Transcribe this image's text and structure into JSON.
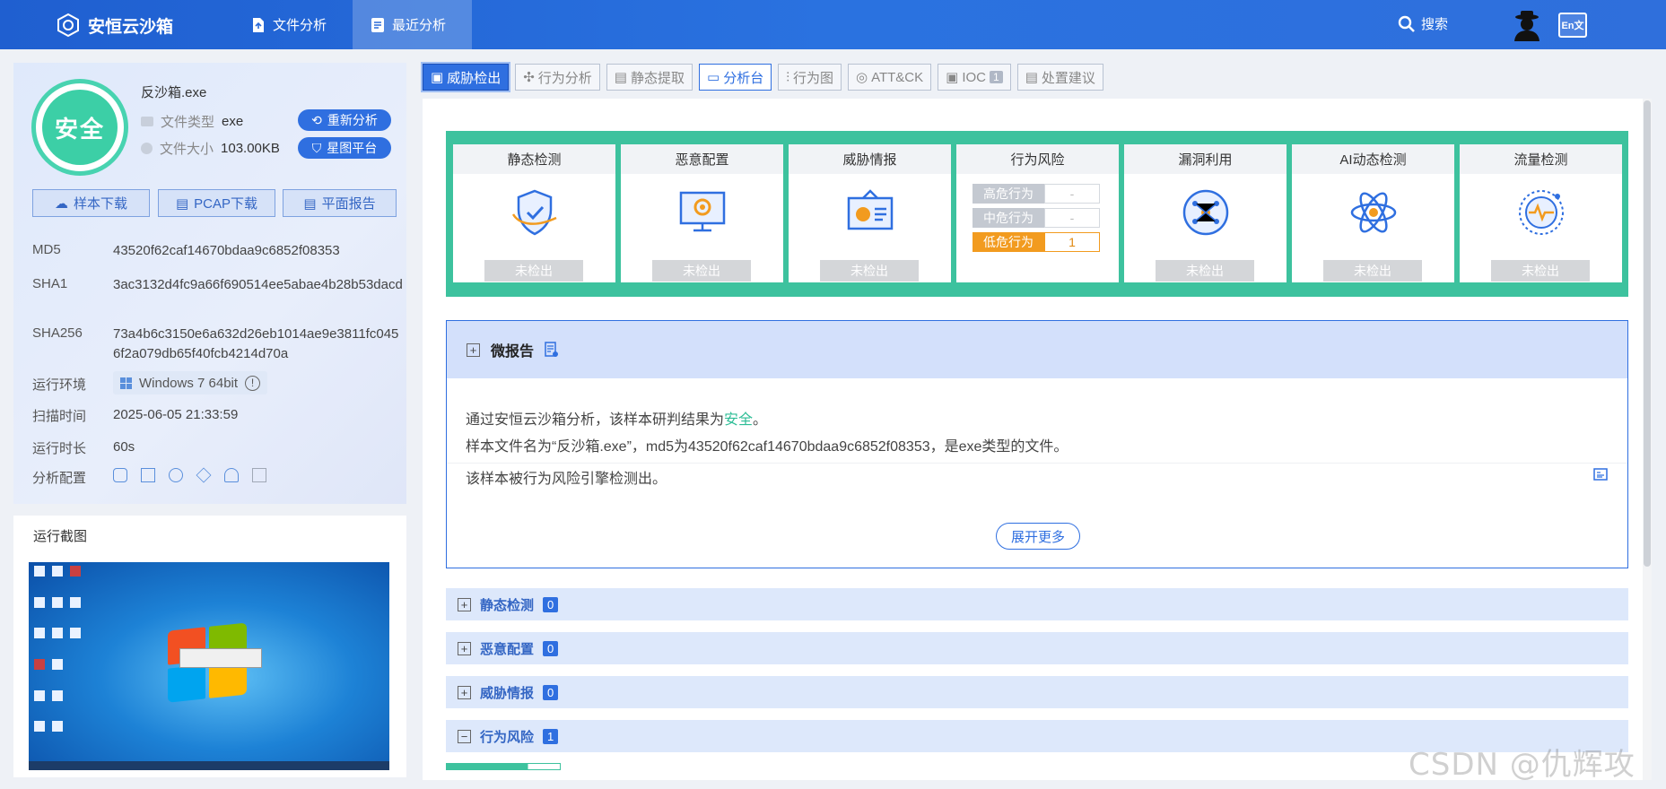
{
  "brand": {
    "name": "安恒云沙箱"
  },
  "nav": {
    "tabs": [
      {
        "label": "文件分析",
        "icon": "upload-file-icon"
      },
      {
        "label": "最近分析",
        "icon": "document-list-icon",
        "active": true
      }
    ],
    "search_label": "搜索",
    "lang_label": "En\n文"
  },
  "file": {
    "verdict": "安全",
    "seal_caption": "安恒云沙箱",
    "name": "反沙箱.exe",
    "type_label": "文件类型",
    "type_value": "exe",
    "size_label": "文件大小",
    "size_value": "103.00KB",
    "reanalyze_label": "重新分析",
    "platform_label": "星图平台"
  },
  "downloads": {
    "sample_label": "样本下载",
    "pcap_label": "PCAP下载",
    "report_label": "平面报告"
  },
  "meta": {
    "md5_label": "MD5",
    "md5_value": "43520f62caf14670bdaa9c6852f08353",
    "sha1_label": "SHA1",
    "sha1_value": "3ac3132d4fc9a66f690514ee5abae4b28b53dacd",
    "sha256_label": "SHA256",
    "sha256_value": "73a4b6c3150e6a632d26eb1014ae9e3811fc0456f2a079db65f40fcb4214d70a",
    "env_label": "运行环境",
    "env_value": "Windows 7 64bit",
    "scan_label": "扫描时间",
    "scan_value": "2025-06-05 21:33:59",
    "duration_label": "运行时长",
    "duration_value": "60s",
    "config_label": "分析配置"
  },
  "screenshot": {
    "title": "运行截图"
  },
  "tabs": [
    {
      "label": "威胁检出",
      "state": "active"
    },
    {
      "label": "行为分析"
    },
    {
      "label": "静态提取"
    },
    {
      "label": "分析台",
      "state": "outlined"
    },
    {
      "label": "行为图"
    },
    {
      "label": "ATT&CK"
    },
    {
      "label": "IOC",
      "badge": "1"
    },
    {
      "label": "处置建议"
    }
  ],
  "detections": [
    {
      "title": "静态检测",
      "status": "未检出",
      "icon": "shield-check-icon"
    },
    {
      "title": "恶意配置",
      "status": "未检出",
      "icon": "monitor-gear-icon"
    },
    {
      "title": "威胁情报",
      "status": "未检出",
      "icon": "board-chart-icon"
    },
    {
      "title": "行为风险",
      "rows": [
        {
          "label": "高危行为",
          "value": "-"
        },
        {
          "label": "中危行为",
          "value": "-"
        },
        {
          "label": "低危行为",
          "value": "1"
        }
      ]
    },
    {
      "title": "漏洞利用",
      "status": "未检出",
      "icon": "network-node-icon"
    },
    {
      "title": "AI动态检测",
      "status": "未检出",
      "icon": "atom-icon"
    },
    {
      "title": "流量检测",
      "status": "未检出",
      "icon": "pulse-circle-icon"
    }
  ],
  "micro_report": {
    "title": "微报告",
    "line1_prefix": "通过安恒云沙箱分析，该样本研判结果为",
    "line1_verdict": "安全",
    "line1_suffix": "。",
    "line2": "样本文件名为“反沙箱.exe”，md5为43520f62caf14670bdaa9c6852f08353，是exe类型的文件。",
    "line3": "该样本被行为风险引擎检测出。",
    "more_label": "展开更多"
  },
  "sections": [
    {
      "label": "静态检测",
      "count": "0",
      "toggle": "+"
    },
    {
      "label": "恶意配置",
      "count": "0",
      "toggle": "+"
    },
    {
      "label": "威胁情报",
      "count": "0",
      "toggle": "+"
    },
    {
      "label": "行为风险",
      "count": "1",
      "toggle": "−"
    }
  ],
  "watermark": "CSDN @仇辉攻防"
}
